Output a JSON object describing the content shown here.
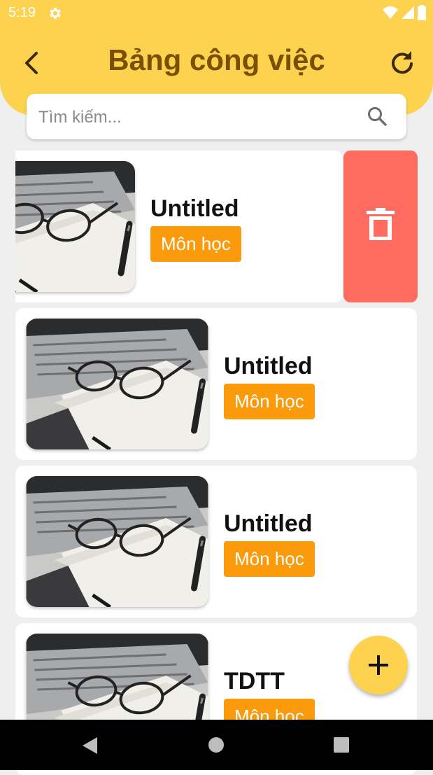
{
  "status_bar": {
    "time": "5:19",
    "icons": [
      "settings-gear-icon",
      "wifi-icon",
      "cellular-signal-icon",
      "battery-icon"
    ]
  },
  "header": {
    "title": "Bảng công việc",
    "back_icon": "chevron-left-icon",
    "refresh_icon": "refresh-icon"
  },
  "search": {
    "placeholder": "Tìm kiếm...",
    "value": "",
    "icon": "search-icon"
  },
  "tasks": [
    {
      "title": "Untitled",
      "tag": "Môn học",
      "swiped": true
    },
    {
      "title": "Untitled",
      "tag": "Môn học",
      "swiped": false
    },
    {
      "title": "Untitled",
      "tag": "Môn học",
      "swiped": false
    },
    {
      "title": "TDTT",
      "tag": "Môn học",
      "swiped": false
    }
  ],
  "swipe_action": {
    "icon": "trash-icon"
  },
  "fab": {
    "icon": "plus-icon"
  },
  "nav_bar": {
    "icons": [
      "nav-back-icon",
      "nav-home-icon",
      "nav-recent-icon"
    ]
  },
  "colors": {
    "header": "#fdd24e",
    "title": "#7a5000",
    "tag": "#fb9a0b",
    "delete": "#ff6b5f",
    "background": "#efefef"
  }
}
